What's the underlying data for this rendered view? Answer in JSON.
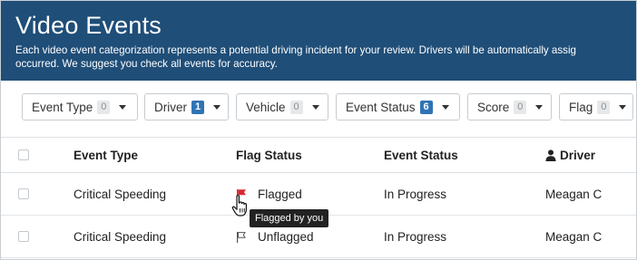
{
  "banner": {
    "title": "Video Events",
    "description_line1": "Each video event categorization represents a potential driving incident for your review. Drivers will be automatically assig",
    "description_line2": "occurred. We suggest you check all events for accuracy."
  },
  "filters": [
    {
      "label": "Event Type",
      "count": "0",
      "active": false
    },
    {
      "label": "Driver",
      "count": "1",
      "active": true
    },
    {
      "label": "Vehicle",
      "count": "0",
      "active": false
    },
    {
      "label": "Event Status",
      "count": "6",
      "active": true
    },
    {
      "label": "Score",
      "count": "0",
      "active": false
    },
    {
      "label": "Flag",
      "count": "0",
      "active": false
    }
  ],
  "table": {
    "columns": [
      "Event Type",
      "Flag Status",
      "Event Status",
      "Driver"
    ],
    "rows": [
      {
        "event_type": "Critical Speeding",
        "flag_status": "Flagged",
        "event_status": "In Progress",
        "driver": "Meagan C"
      },
      {
        "event_type": "Critical Speeding",
        "flag_status": "Unflagged",
        "event_status": "In Progress",
        "driver": "Meagan C"
      }
    ]
  },
  "tooltip": {
    "text": "Flagged by you"
  },
  "colors": {
    "banner": "#1f4e78",
    "flag_red": "#d9282f",
    "badge_active": "#2f74b5"
  }
}
